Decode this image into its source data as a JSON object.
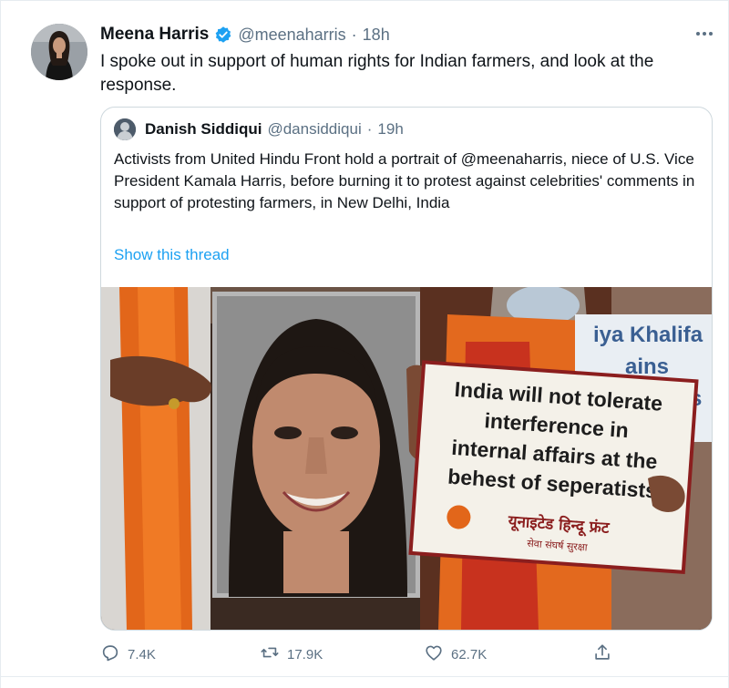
{
  "tweet": {
    "author_name": "Meena Harris",
    "author_handle": "@meenaharris",
    "separator": "·",
    "time": "18h",
    "text": "I spoke out in support of human rights for Indian farmers, and look at the response."
  },
  "quoted": {
    "author_name": "Danish Siddiqui",
    "author_handle": "@dansiddiqui",
    "separator": "·",
    "time": "19h",
    "text": "Activists from United Hindu Front hold a portrait of @meenaharris, niece of U.S. Vice President Kamala Harris, before burning it to protest against celebrities' comments in support of protesting farmers, in New Delhi, India",
    "show_thread": "Show this thread",
    "photo": {
      "placard_lines": [
        "India will not tolerate",
        "interference in",
        "internal affairs at the",
        "behest of seperatists"
      ],
      "placard_footer": "यूनाइटेड हिन्दू फ्रंट",
      "placard_tagline": "सेवा संघर्ष सुरक्षा",
      "back_sign_lines": [
        "iya Khalifa",
        "ains",
        "usnes"
      ]
    }
  },
  "actions": {
    "replies": "7.4K",
    "retweets": "17.9K",
    "likes": "62.7K"
  },
  "colors": {
    "accent": "#1da1f2",
    "secondary_text": "#5b7083",
    "border": "#cfd9de"
  },
  "icons": [
    "verified-badge-icon",
    "more-icon",
    "reply-icon",
    "retweet-icon",
    "like-icon",
    "share-icon"
  ]
}
